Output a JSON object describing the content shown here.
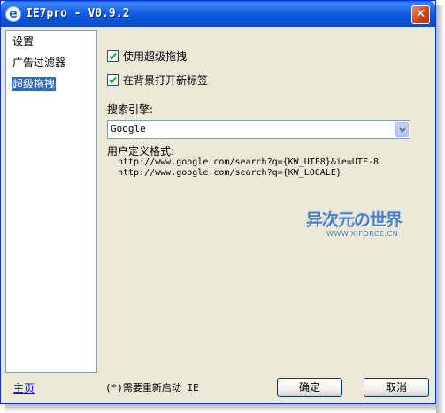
{
  "window": {
    "title": "IE7pro - V0.9.2",
    "icon": "ie-icon",
    "close_symbol": "✕"
  },
  "sidebar": {
    "items": [
      {
        "label": "设置",
        "selected": false
      },
      {
        "label": "广告过滤器",
        "selected": false
      },
      {
        "label": "超级拖拽",
        "selected": true
      }
    ]
  },
  "main": {
    "checkboxes": [
      {
        "label": "使用超级拖拽",
        "checked": true
      },
      {
        "label": "在背景打开新标签",
        "checked": true
      }
    ],
    "search_engine_label": "搜索引擎:",
    "search_engine_value": "Google",
    "custom_format_label": "用户定义格式:",
    "custom_format_lines": [
      "http://www.google.com/search?q={KW_UTF8}&ie=UTF-8",
      "http://www.google.com/search?q={KW_LOCALE}"
    ]
  },
  "watermark": {
    "title": "异次元の世界",
    "subtitle": "WWW.X-FORCE.CN"
  },
  "footer": {
    "home_link": "主页",
    "restart_note": "(*)需要重新启动 IE",
    "ok_label": "确定",
    "cancel_label": "取消"
  },
  "colors": {
    "titlebar": "#0a4bc8",
    "selected_item": "#316ac5",
    "link": "#0000ff",
    "window_bg": "#ece9d8"
  }
}
